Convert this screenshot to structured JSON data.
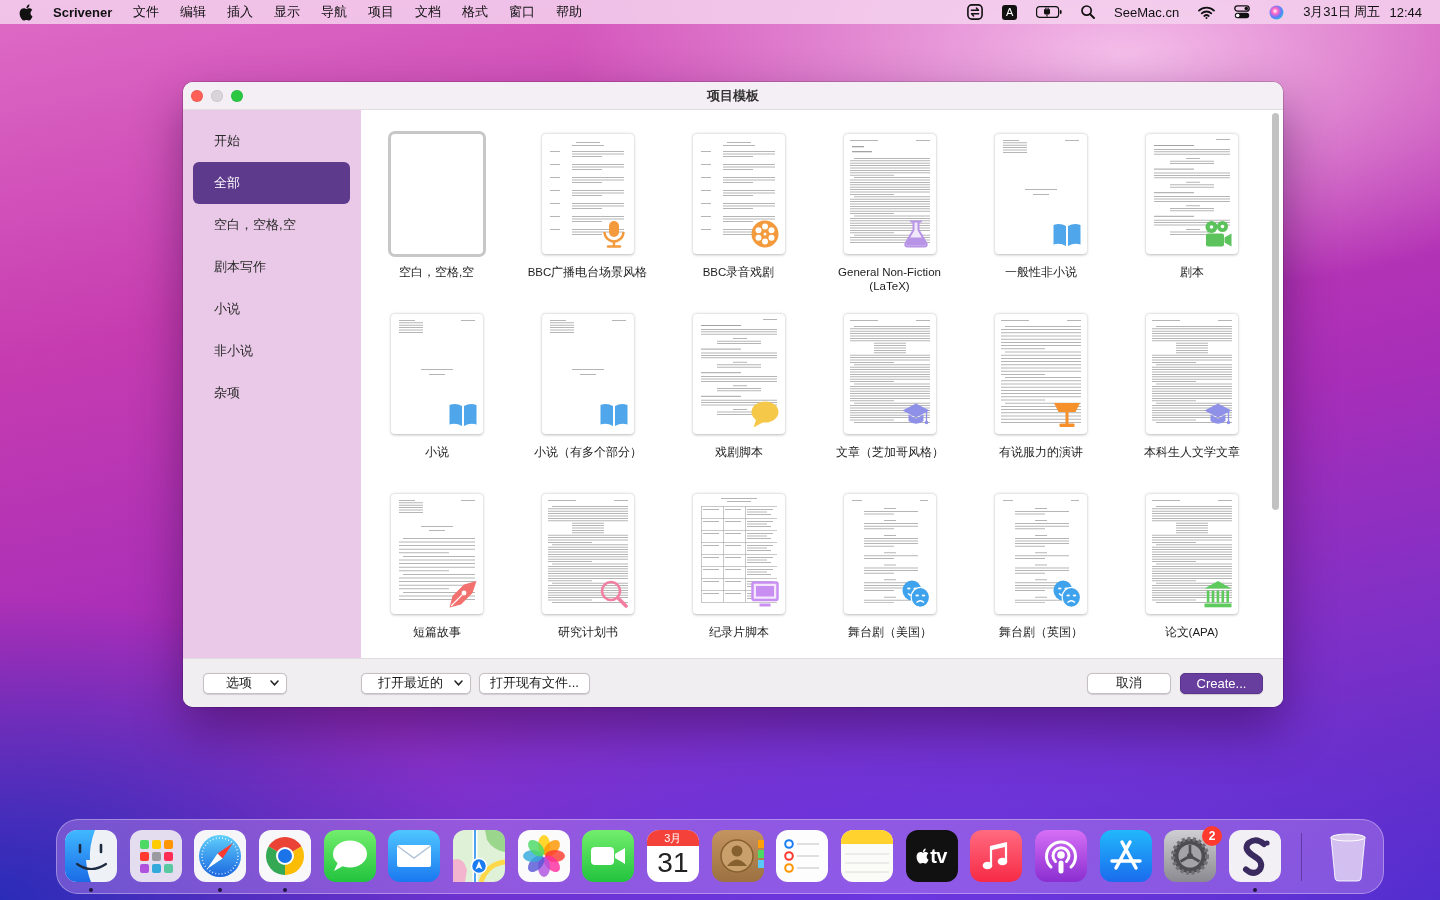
{
  "menu_bar": {
    "app_name": "Scrivener",
    "menus": [
      "文件",
      "编辑",
      "插入",
      "显示",
      "导航",
      "项目",
      "文档",
      "格式",
      "窗口",
      "帮助"
    ],
    "input_source": "A",
    "extra": "SeeMac.cn",
    "date": "3月31日 周五",
    "time": "12:44"
  },
  "window": {
    "title": "项目模板",
    "controls": [
      {
        "kind": "close",
        "disabled": false
      },
      {
        "kind": "minimize",
        "disabled": true
      },
      {
        "kind": "zoom",
        "disabled": false
      }
    ]
  },
  "sidebar": {
    "items": [
      {
        "label": "开始",
        "selected": false
      },
      {
        "label": "全部",
        "selected": true
      },
      {
        "label": "空白，空格,空",
        "selected": false
      },
      {
        "label": "剧本写作",
        "selected": false
      },
      {
        "label": "小说",
        "selected": false
      },
      {
        "label": "非小说",
        "selected": false
      },
      {
        "label": "杂项",
        "selected": false
      }
    ]
  },
  "templates": [
    {
      "label": "空白，空格,空",
      "kind": "blank",
      "selected": true
    },
    {
      "label": "BBC广播电台场景风格",
      "kind": "radio",
      "selected": false
    },
    {
      "label": "BBC录音戏剧",
      "kind": "audio",
      "selected": false
    },
    {
      "label": "General Non-Fiction (LaTeX)",
      "kind": "latex",
      "selected": false
    },
    {
      "label": "一般性非小说",
      "kind": "nonfiction",
      "selected": false
    },
    {
      "label": "剧本",
      "kind": "screenplay",
      "selected": false
    },
    {
      "label": "小说",
      "kind": "novel",
      "selected": false
    },
    {
      "label": "小说（有多个部分）",
      "kind": "novel",
      "selected": false
    },
    {
      "label": "戏剧脚本",
      "kind": "comic",
      "selected": false
    },
    {
      "label": "文章（芝加哥风格）",
      "kind": "essay",
      "selected": false
    },
    {
      "label": "有说服力的演讲",
      "kind": "speech",
      "selected": false
    },
    {
      "label": "本科生人文学文章",
      "kind": "essay",
      "selected": false
    },
    {
      "label": "短篇故事",
      "kind": "story",
      "selected": false
    },
    {
      "label": "研究计划书",
      "kind": "research",
      "selected": false
    },
    {
      "label": "纪录片脚本",
      "kind": "documentary",
      "selected": false
    },
    {
      "label": "舞台剧（美国）",
      "kind": "stageplay",
      "selected": false
    },
    {
      "label": "舞台剧（英国）",
      "kind": "stageplay",
      "selected": false
    },
    {
      "label": "论文(APA)",
      "kind": "apa",
      "selected": false
    }
  ],
  "footer": {
    "options_menu": "选项",
    "recent_menu": "打开最近的",
    "open_button": "打开现有文件...",
    "cancel_button": "取消",
    "create_button": "Create..."
  },
  "dock": {
    "apps": [
      {
        "kind": "face",
        "running": true
      },
      {
        "kind": "grid",
        "running": false
      },
      {
        "kind": "compass",
        "running": true
      },
      {
        "kind": "ring",
        "running": true
      },
      {
        "kind": "chat",
        "running": false
      },
      {
        "kind": "envelope",
        "running": false
      },
      {
        "kind": "map",
        "running": false
      },
      {
        "kind": "flower",
        "running": false
      },
      {
        "kind": "camera",
        "running": false
      },
      {
        "kind": "calendar",
        "running": false,
        "month": "3月",
        "day": "31"
      },
      {
        "kind": "contact",
        "running": false
      },
      {
        "kind": "checklist",
        "running": false
      },
      {
        "kind": "notepad",
        "running": false
      },
      {
        "kind": "tv",
        "running": false,
        "label": "tv"
      },
      {
        "kind": "note",
        "running": false
      },
      {
        "kind": "podcast",
        "running": false
      },
      {
        "kind": "astore",
        "running": false
      },
      {
        "kind": "gear",
        "running": false,
        "badge": "2"
      },
      {
        "kind": "swirl",
        "running": true
      }
    ]
  }
}
